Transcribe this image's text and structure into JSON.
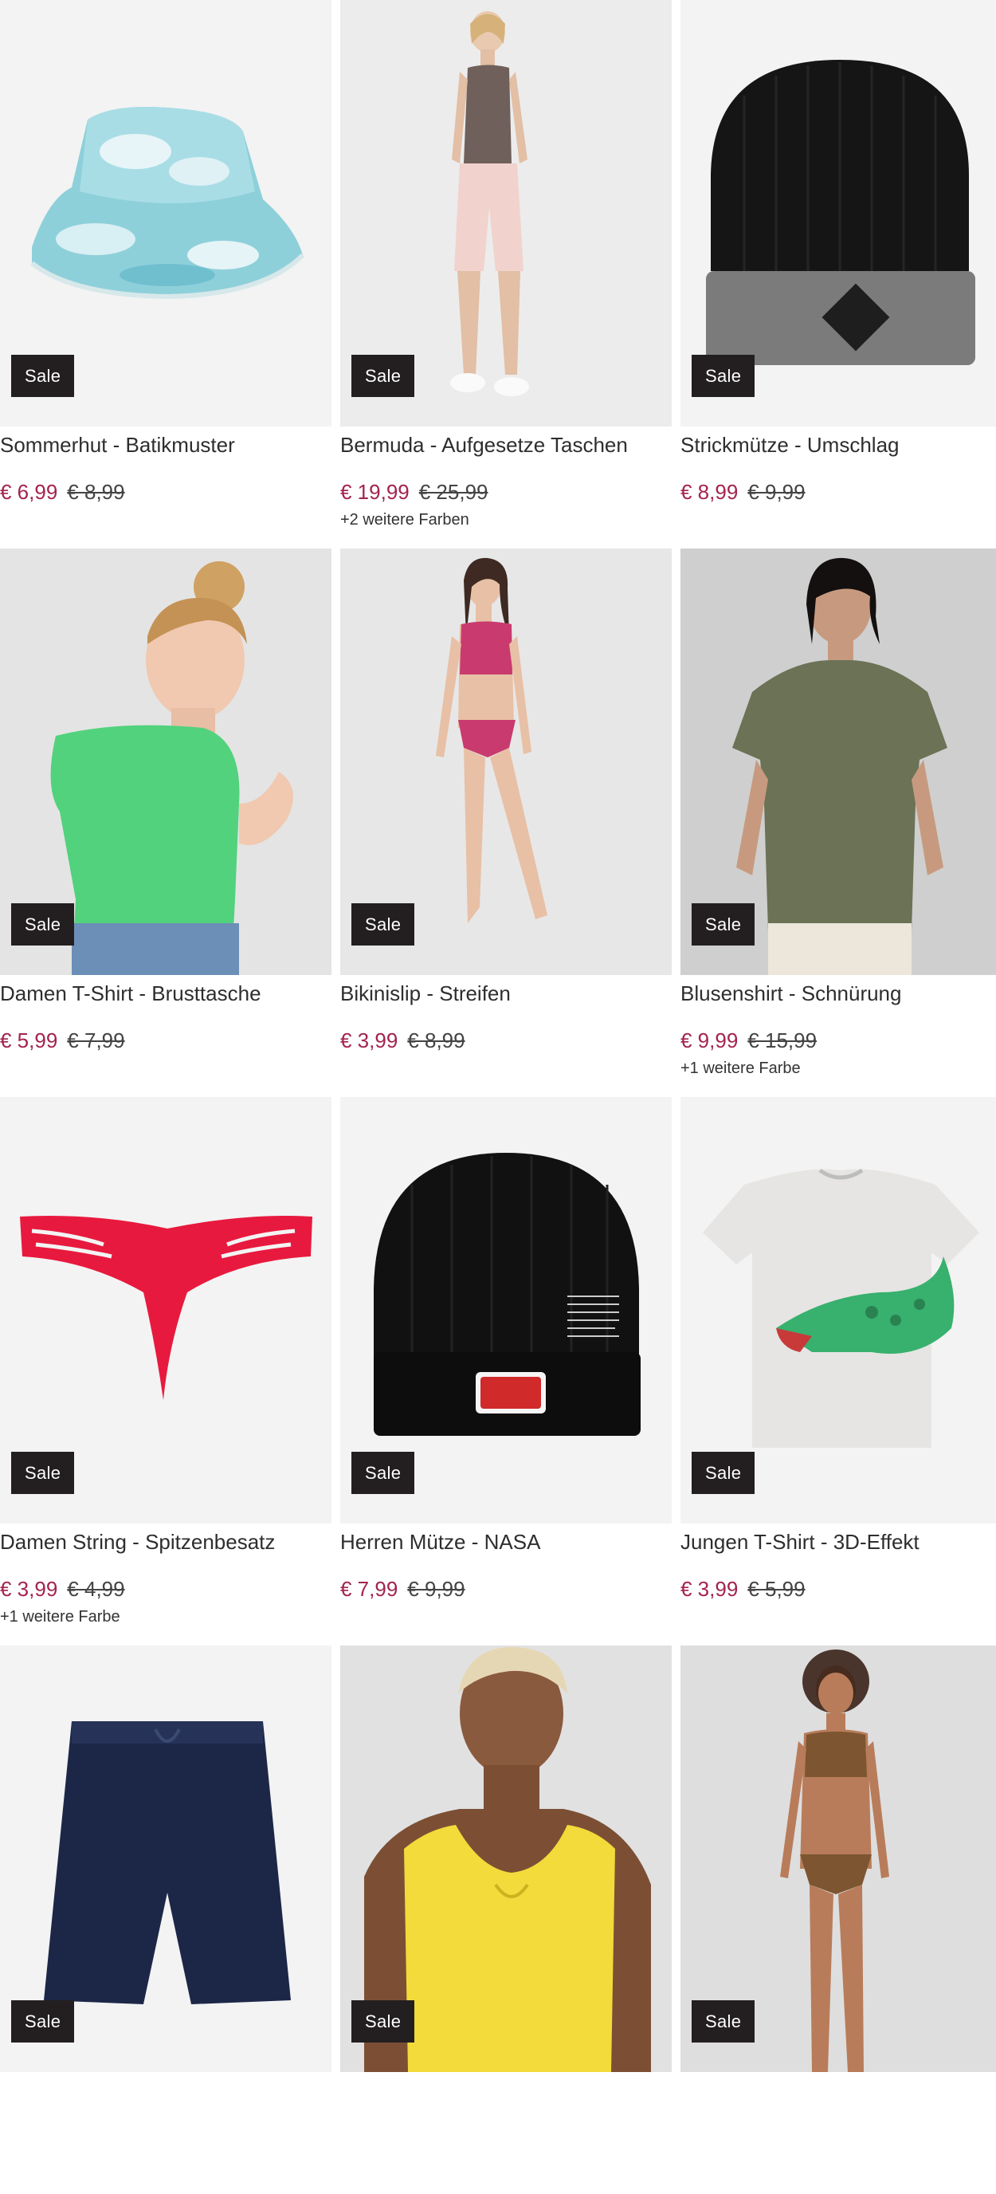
{
  "badge_label": "Sale",
  "accent_color": "#a3244f",
  "products": [
    {
      "name": "Sommerhut - Batikmuster",
      "price": "€ 6,99",
      "old_price": "€ 8,99",
      "more_colors": "",
      "image": "bucket-hat-tie-dye"
    },
    {
      "name": "Bermuda - Aufgesetze Taschen",
      "price": "€ 19,99",
      "old_price": "€ 25,99",
      "more_colors": "+2 weitere Farben",
      "image": "model-bermuda-shorts"
    },
    {
      "name": "Strickmütze - Umschlag",
      "price": "€ 8,99",
      "old_price": "€ 9,99",
      "more_colors": "",
      "image": "black-beanie"
    },
    {
      "name": "Damen T-Shirt - Brusttasche",
      "price": "€ 5,99",
      "old_price": "€ 7,99",
      "more_colors": "",
      "image": "model-green-tshirt"
    },
    {
      "name": "Bikinislip - Streifen",
      "price": "€ 3,99",
      "old_price": "€ 8,99",
      "more_colors": "",
      "image": "model-pink-bikini"
    },
    {
      "name": "Blusenshirt - Schnürung",
      "price": "€ 9,99",
      "old_price": "€ 15,99",
      "more_colors": "+1 weitere Farbe",
      "image": "model-olive-blouse"
    },
    {
      "name": "Damen String - Spitzenbesatz",
      "price": "€ 3,99",
      "old_price": "€ 4,99",
      "more_colors": "+1 weitere Farbe",
      "image": "red-string"
    },
    {
      "name": "Herren Mütze - NASA",
      "price": "€ 7,99",
      "old_price": "€ 9,99",
      "more_colors": "",
      "image": "nasa-beanie"
    },
    {
      "name": "Jungen T-Shirt - 3D-Effekt",
      "price": "€ 3,99",
      "old_price": "€ 5,99",
      "more_colors": "",
      "image": "crocodile-tshirt"
    },
    {
      "name": "",
      "price": "",
      "old_price": "",
      "more_colors": "",
      "image": "navy-shorts"
    },
    {
      "name": "",
      "price": "",
      "old_price": "",
      "more_colors": "",
      "image": "model-yellow-top"
    },
    {
      "name": "",
      "price": "",
      "old_price": "",
      "more_colors": "",
      "image": "model-leopard-bikini"
    }
  ]
}
